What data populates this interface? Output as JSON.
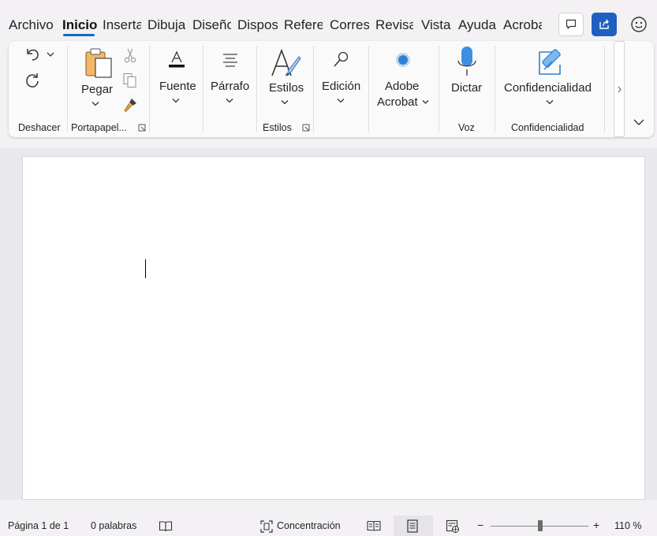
{
  "tabs": [
    {
      "label": "Archivo",
      "active": false
    },
    {
      "label": "Inicio",
      "active": true
    },
    {
      "label": "Inserta",
      "active": false
    },
    {
      "label": "Dibuja",
      "active": false
    },
    {
      "label": "Diseño",
      "active": false
    },
    {
      "label": "Dispos",
      "active": false
    },
    {
      "label": "Refere",
      "active": false
    },
    {
      "label": "Corres",
      "active": false
    },
    {
      "label": "Revisa",
      "active": false
    },
    {
      "label": "Vista",
      "active": false
    },
    {
      "label": "Ayuda",
      "active": false
    },
    {
      "label": "Acrobat",
      "active": false
    }
  ],
  "accent_color": "#0f6cbd",
  "ribbon": {
    "undo_group": "Deshacer",
    "clipboard": {
      "paste_label": "Pegar",
      "group": "Portapapel..."
    },
    "font": {
      "label": "Fuente"
    },
    "paragraph": {
      "label": "Párrafo"
    },
    "styles": {
      "label": "Estilos",
      "group": "Estilos"
    },
    "editing": {
      "label": "Edición"
    },
    "adobe": {
      "line1": "Adobe",
      "line2": "Acrobat"
    },
    "voice": {
      "label": "Dictar",
      "group": "Voz"
    },
    "sensitivity": {
      "label": "Confidencialidad",
      "group": "Confidencialidad"
    }
  },
  "status": {
    "page": "Página 1 de 1",
    "words": "0 palabras",
    "focus": "Concentración",
    "zoom_minus": "−",
    "zoom_plus": "+",
    "zoom_level": "110 %",
    "zoom_value": 110
  }
}
